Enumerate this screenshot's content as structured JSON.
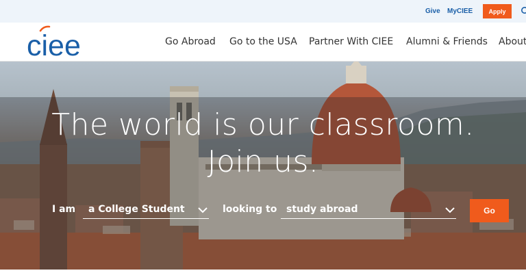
{
  "utility": {
    "give": "Give",
    "myciee": "MyCIEE",
    "apply": "Apply"
  },
  "logo": {
    "text": "ciee"
  },
  "nav": {
    "items": [
      {
        "label": "Go Abroad"
      },
      {
        "label": "Go to the USA"
      },
      {
        "label": "Partner With CIEE"
      },
      {
        "label": "Alumni & Friends"
      },
      {
        "label": "About"
      }
    ]
  },
  "hero": {
    "headline_line1": "The world is our classroom.",
    "headline_line2": "Join us."
  },
  "finder": {
    "label_iam": "I am",
    "select_who": "a College Student",
    "label_looking": "looking to",
    "select_what": "study abroad",
    "go": "Go"
  },
  "colors": {
    "brand_blue": "#1a5fa8",
    "accent_orange": "#f05b1c",
    "utility_bg": "#eef4fa"
  }
}
